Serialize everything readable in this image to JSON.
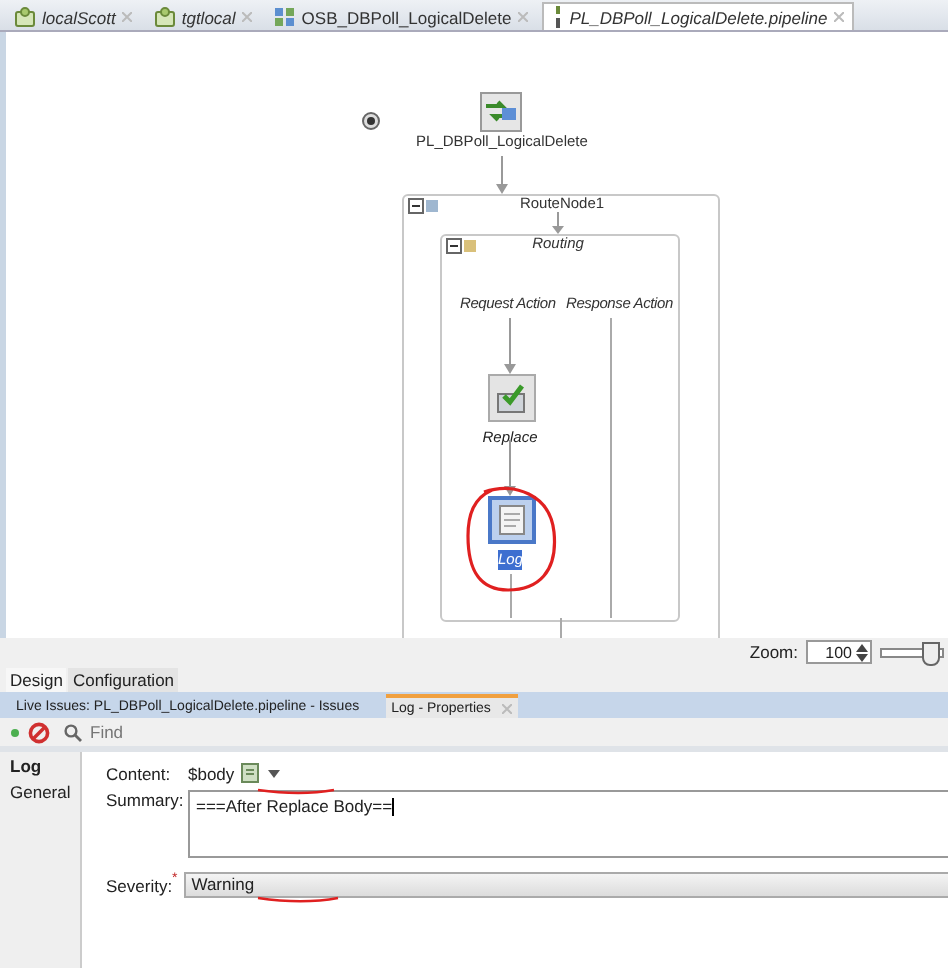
{
  "tabs": [
    {
      "label": "localScott",
      "kind": "server",
      "selected": false
    },
    {
      "label": "tgtlocal",
      "kind": "server",
      "selected": false
    },
    {
      "label": "OSB_DBPoll_LogicalDelete",
      "kind": "project",
      "selected": false
    },
    {
      "label": "PL_DBPoll_LogicalDelete.pipeline",
      "kind": "pipeline",
      "selected": true
    }
  ],
  "diagram": {
    "pipeline": "PL_DBPoll_LogicalDelete",
    "route_node": "RouteNode1",
    "routing": "Routing",
    "request_label": "Request Action",
    "response_label": "Response Action",
    "actions": [
      {
        "label": "Replace",
        "kind": "replace",
        "selected": false
      },
      {
        "label": "Log",
        "kind": "log",
        "selected": true
      }
    ]
  },
  "zoom": {
    "label": "Zoom:",
    "value": "100",
    "level": 0.8
  },
  "view_tabs": [
    {
      "label": "Design",
      "selected": true
    },
    {
      "label": "Configuration",
      "selected": false
    }
  ],
  "panel_tabs": [
    {
      "label": "Live Issues: PL_DBPoll_LogicalDelete.pipeline - Issues",
      "selected": false
    },
    {
      "label": "Log - Properties",
      "selected": true
    }
  ],
  "find": {
    "placeholder": "Find"
  },
  "property_sections": [
    {
      "label": "Log",
      "selected": true
    },
    {
      "label": "General",
      "selected": false
    }
  ],
  "form": {
    "content_label": "Content:",
    "content_value": "$body",
    "summary_label": "Summary:",
    "summary_value": "===After Replace Body==",
    "severity_label": "Severity:",
    "required_mark": "*",
    "severity_value": "Warning"
  }
}
